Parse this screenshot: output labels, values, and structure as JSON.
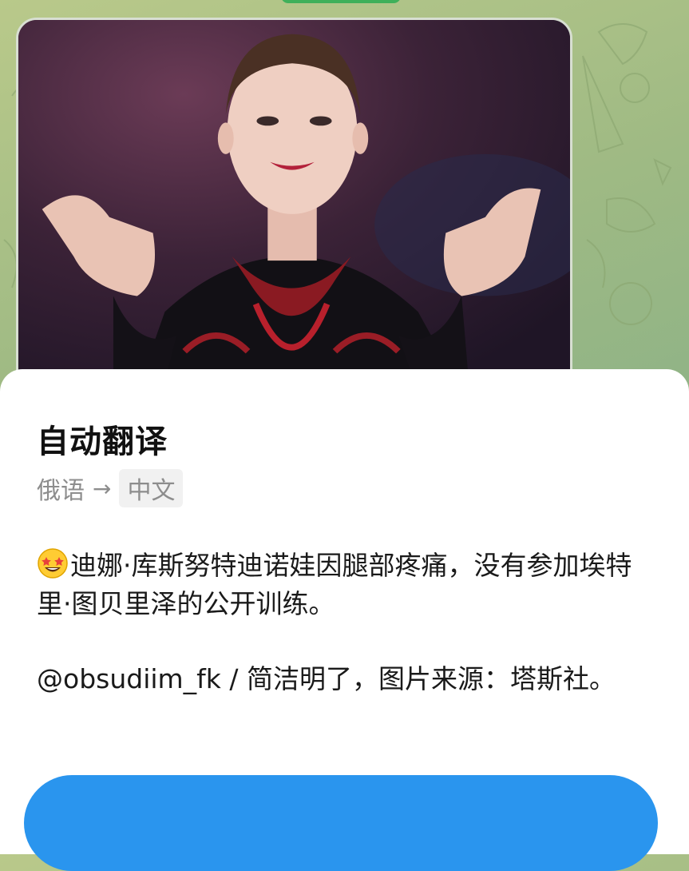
{
  "photo": {
    "description_icon": "photo-thumbnail"
  },
  "sheet": {
    "title": "自动翻译",
    "source_language": "俄语",
    "arrow": "→",
    "target_language": "中文",
    "paragraph_1": "迪娜·库斯努特迪诺娃因腿部疼痛，没有参加埃特里·图贝里泽的公开训练。",
    "paragraph_1_emoji": "star-struck-emoji",
    "paragraph_2": "@obsudiim_fk / 简洁明了，图片来源：塔斯社。",
    "button_label": ""
  },
  "colors": {
    "accent_button": "#2a95ee",
    "chat_background": "#9fba84",
    "sheet_background": "#ffffff"
  }
}
